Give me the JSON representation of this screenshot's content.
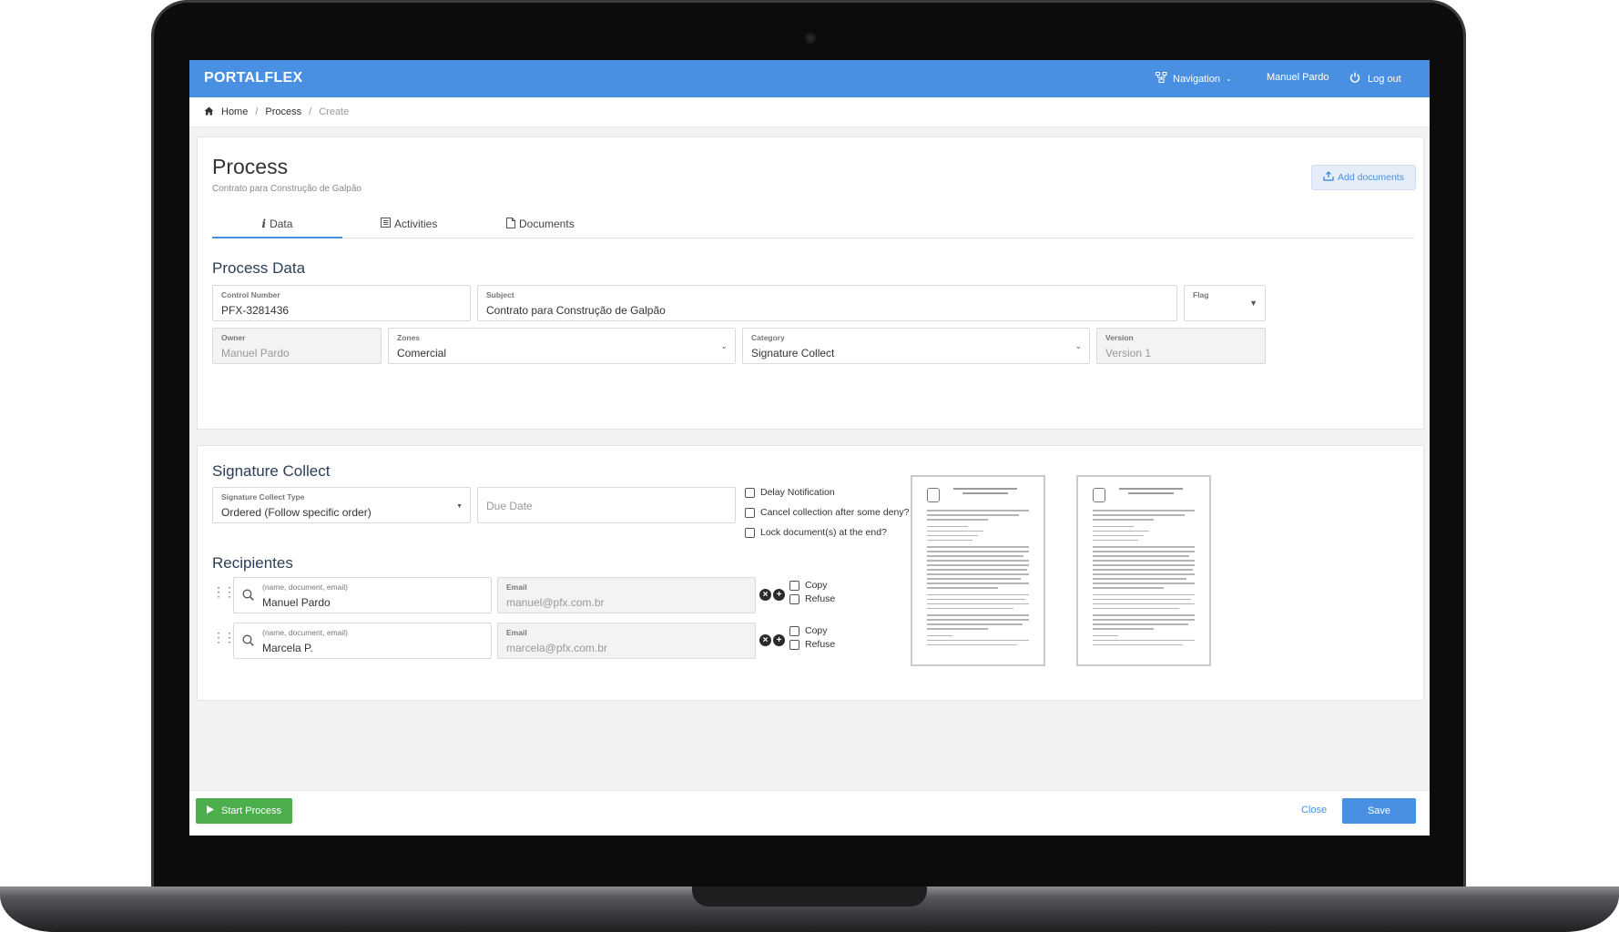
{
  "topbar": {
    "logo": "PORTALFLEX",
    "navigation_label": "Navigation",
    "user_name": "Manuel Pardo",
    "logout_label": "Log out"
  },
  "breadcrumb": {
    "home": "Home",
    "process": "Process",
    "current": "Create"
  },
  "header": {
    "title": "Process",
    "subtitle": "Contrato para Construção de Galpão",
    "add_documents_label": "Add documents"
  },
  "tabs": [
    {
      "label": "Data",
      "active": true
    },
    {
      "label": "Activities",
      "active": false
    },
    {
      "label": "Documents",
      "active": false
    }
  ],
  "process_data": {
    "section_title": "Process Data",
    "control_number": {
      "label": "Control Number",
      "value": "PFX-3281436"
    },
    "subject": {
      "label": "Subject",
      "value": "Contrato para Construção de Galpão"
    },
    "flag": {
      "label": "Flag",
      "value": ""
    },
    "owner": {
      "label": "Owner",
      "value": "Manuel Pardo"
    },
    "zones": {
      "label": "Zones",
      "value": "Comercial"
    },
    "category": {
      "label": "Category",
      "value": "Signature Collect"
    },
    "version": {
      "label": "Version",
      "value": "Version 1"
    }
  },
  "signature_collect": {
    "section_title": "Signature Collect",
    "type": {
      "label": "Signature Collect Type",
      "value": "Ordered (Follow specific order)"
    },
    "due_date_placeholder": "Due Date",
    "options": [
      {
        "label": "Delay Notification",
        "checked": false
      },
      {
        "label": "Cancel collection after some deny?",
        "checked": false
      },
      {
        "label": "Lock document(s) at the end?",
        "checked": false
      }
    ]
  },
  "recipients": {
    "section_title": "Recipientes",
    "rows": [
      {
        "search_label": "(name, document, email)",
        "name": "Manuel Pardo",
        "email_label": "Email",
        "email": "manuel@pfx.com.br",
        "copy_label": "Copy",
        "refuse_label": "Refuse"
      },
      {
        "search_label": "(name, document, email)",
        "name": "Marcela P.",
        "email_label": "Email",
        "email": "marcela@pfx.com.br",
        "copy_label": "Copy",
        "refuse_label": "Refuse"
      }
    ]
  },
  "footer": {
    "start_label": "Start Process",
    "close_label": "Close",
    "save_label": "Save"
  },
  "colors": {
    "primary": "#4a90e2",
    "success": "#4cae4c"
  }
}
